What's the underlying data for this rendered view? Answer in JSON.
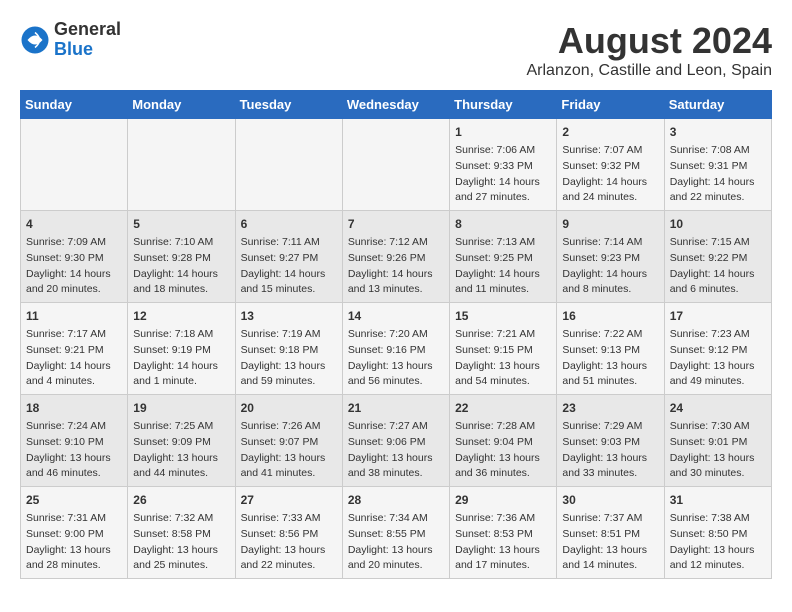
{
  "header": {
    "logo_text_general": "General",
    "logo_text_blue": "Blue",
    "month_year": "August 2024",
    "location": "Arlanzon, Castille and Leon, Spain"
  },
  "calendar": {
    "days_of_week": [
      "Sunday",
      "Monday",
      "Tuesday",
      "Wednesday",
      "Thursday",
      "Friday",
      "Saturday"
    ],
    "weeks": [
      {
        "days": [
          {
            "number": "",
            "info": ""
          },
          {
            "number": "",
            "info": ""
          },
          {
            "number": "",
            "info": ""
          },
          {
            "number": "",
            "info": ""
          },
          {
            "number": "1",
            "info": "Sunrise: 7:06 AM\nSunset: 9:33 PM\nDaylight: 14 hours\nand 27 minutes."
          },
          {
            "number": "2",
            "info": "Sunrise: 7:07 AM\nSunset: 9:32 PM\nDaylight: 14 hours\nand 24 minutes."
          },
          {
            "number": "3",
            "info": "Sunrise: 7:08 AM\nSunset: 9:31 PM\nDaylight: 14 hours\nand 22 minutes."
          }
        ]
      },
      {
        "days": [
          {
            "number": "4",
            "info": "Sunrise: 7:09 AM\nSunset: 9:30 PM\nDaylight: 14 hours\nand 20 minutes."
          },
          {
            "number": "5",
            "info": "Sunrise: 7:10 AM\nSunset: 9:28 PM\nDaylight: 14 hours\nand 18 minutes."
          },
          {
            "number": "6",
            "info": "Sunrise: 7:11 AM\nSunset: 9:27 PM\nDaylight: 14 hours\nand 15 minutes."
          },
          {
            "number": "7",
            "info": "Sunrise: 7:12 AM\nSunset: 9:26 PM\nDaylight: 14 hours\nand 13 minutes."
          },
          {
            "number": "8",
            "info": "Sunrise: 7:13 AM\nSunset: 9:25 PM\nDaylight: 14 hours\nand 11 minutes."
          },
          {
            "number": "9",
            "info": "Sunrise: 7:14 AM\nSunset: 9:23 PM\nDaylight: 14 hours\nand 8 minutes."
          },
          {
            "number": "10",
            "info": "Sunrise: 7:15 AM\nSunset: 9:22 PM\nDaylight: 14 hours\nand 6 minutes."
          }
        ]
      },
      {
        "days": [
          {
            "number": "11",
            "info": "Sunrise: 7:17 AM\nSunset: 9:21 PM\nDaylight: 14 hours\nand 4 minutes."
          },
          {
            "number": "12",
            "info": "Sunrise: 7:18 AM\nSunset: 9:19 PM\nDaylight: 14 hours\nand 1 minute."
          },
          {
            "number": "13",
            "info": "Sunrise: 7:19 AM\nSunset: 9:18 PM\nDaylight: 13 hours\nand 59 minutes."
          },
          {
            "number": "14",
            "info": "Sunrise: 7:20 AM\nSunset: 9:16 PM\nDaylight: 13 hours\nand 56 minutes."
          },
          {
            "number": "15",
            "info": "Sunrise: 7:21 AM\nSunset: 9:15 PM\nDaylight: 13 hours\nand 54 minutes."
          },
          {
            "number": "16",
            "info": "Sunrise: 7:22 AM\nSunset: 9:13 PM\nDaylight: 13 hours\nand 51 minutes."
          },
          {
            "number": "17",
            "info": "Sunrise: 7:23 AM\nSunset: 9:12 PM\nDaylight: 13 hours\nand 49 minutes."
          }
        ]
      },
      {
        "days": [
          {
            "number": "18",
            "info": "Sunrise: 7:24 AM\nSunset: 9:10 PM\nDaylight: 13 hours\nand 46 minutes."
          },
          {
            "number": "19",
            "info": "Sunrise: 7:25 AM\nSunset: 9:09 PM\nDaylight: 13 hours\nand 44 minutes."
          },
          {
            "number": "20",
            "info": "Sunrise: 7:26 AM\nSunset: 9:07 PM\nDaylight: 13 hours\nand 41 minutes."
          },
          {
            "number": "21",
            "info": "Sunrise: 7:27 AM\nSunset: 9:06 PM\nDaylight: 13 hours\nand 38 minutes."
          },
          {
            "number": "22",
            "info": "Sunrise: 7:28 AM\nSunset: 9:04 PM\nDaylight: 13 hours\nand 36 minutes."
          },
          {
            "number": "23",
            "info": "Sunrise: 7:29 AM\nSunset: 9:03 PM\nDaylight: 13 hours\nand 33 minutes."
          },
          {
            "number": "24",
            "info": "Sunrise: 7:30 AM\nSunset: 9:01 PM\nDaylight: 13 hours\nand 30 minutes."
          }
        ]
      },
      {
        "days": [
          {
            "number": "25",
            "info": "Sunrise: 7:31 AM\nSunset: 9:00 PM\nDaylight: 13 hours\nand 28 minutes."
          },
          {
            "number": "26",
            "info": "Sunrise: 7:32 AM\nSunset: 8:58 PM\nDaylight: 13 hours\nand 25 minutes."
          },
          {
            "number": "27",
            "info": "Sunrise: 7:33 AM\nSunset: 8:56 PM\nDaylight: 13 hours\nand 22 minutes."
          },
          {
            "number": "28",
            "info": "Sunrise: 7:34 AM\nSunset: 8:55 PM\nDaylight: 13 hours\nand 20 minutes."
          },
          {
            "number": "29",
            "info": "Sunrise: 7:36 AM\nSunset: 8:53 PM\nDaylight: 13 hours\nand 17 minutes."
          },
          {
            "number": "30",
            "info": "Sunrise: 7:37 AM\nSunset: 8:51 PM\nDaylight: 13 hours\nand 14 minutes."
          },
          {
            "number": "31",
            "info": "Sunrise: 7:38 AM\nSunset: 8:50 PM\nDaylight: 13 hours\nand 12 minutes."
          }
        ]
      }
    ]
  }
}
